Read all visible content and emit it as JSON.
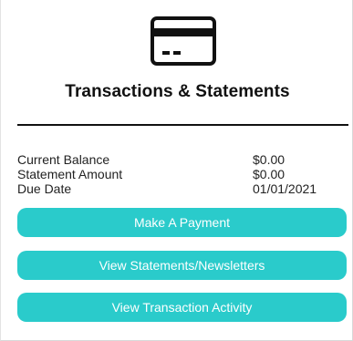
{
  "icon": "credit-card-icon",
  "title": "Transactions & Statements",
  "details": [
    {
      "label": "Current Balance",
      "value": "$0.00"
    },
    {
      "label": "Statement Amount",
      "value": "$0.00"
    },
    {
      "label": "Due Date",
      "value": "01/01/2021"
    }
  ],
  "actions": {
    "make_payment": "Make A Payment",
    "view_statements": "View Statements/Newsletters",
    "view_activity": "View Transaction Activity"
  },
  "colors": {
    "button": "#2acbcb",
    "button_text": "#ffffff",
    "text": "#111111"
  }
}
